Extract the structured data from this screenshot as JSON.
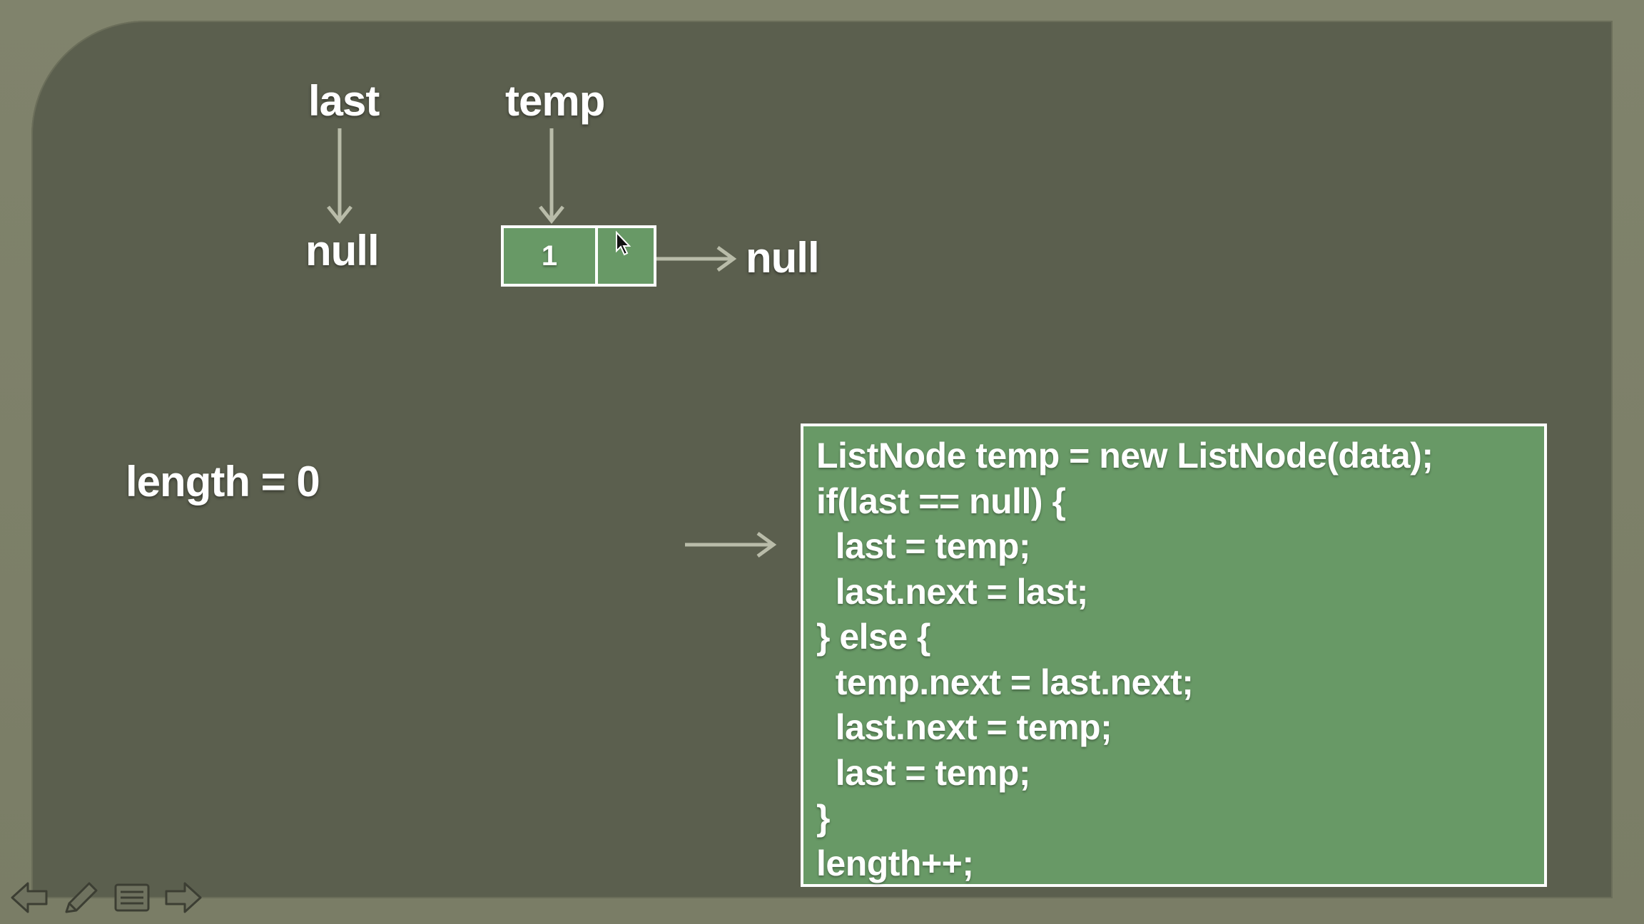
{
  "diagram": {
    "pointer_last": "last",
    "pointer_temp": "temp",
    "last_target": "null",
    "node_value": "1",
    "node_next_target": "null",
    "length_text": "length = 0"
  },
  "code": {
    "lines": [
      "ListNode temp = new ListNode(data);",
      "if(last == null) {",
      "  last = temp;",
      "  last.next = last;",
      "} else {",
      "  temp.next = last.next;",
      "  last.next = temp;",
      "  last = temp;",
      "}",
      "length++;"
    ]
  },
  "colors": {
    "slide_bg": "#5b5f4e",
    "frame_bg": "#7d8068",
    "node_fill": "#689966",
    "code_fill": "#689966",
    "text": "#ffffff",
    "arrow": "#b9bca9"
  },
  "nav": {
    "icons": [
      "arrow-left-icon",
      "pen-icon",
      "menu-icon",
      "arrow-right-icon"
    ]
  }
}
